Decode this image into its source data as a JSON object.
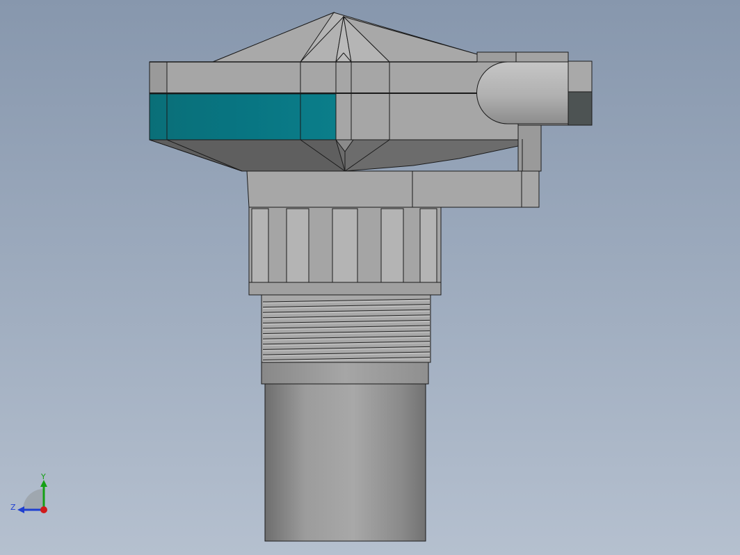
{
  "viewport": {
    "background_top": "#8797ad",
    "background_bottom": "#b5c0cf"
  },
  "model": {
    "name": "sensor-housing-3d-model",
    "colors": {
      "body": "#a4a4a4",
      "body_light": "#bdbdbd",
      "body_dark": "#6b6b6b",
      "accent_band": "#087582",
      "edge": "#1a1a1a",
      "cap_dark": "#4d5353"
    }
  },
  "triad": {
    "x_label": "Z",
    "y_label": "Y",
    "x_color": "#1f3fd0",
    "y_color": "#15a015",
    "origin_color": "#d01a1a"
  }
}
